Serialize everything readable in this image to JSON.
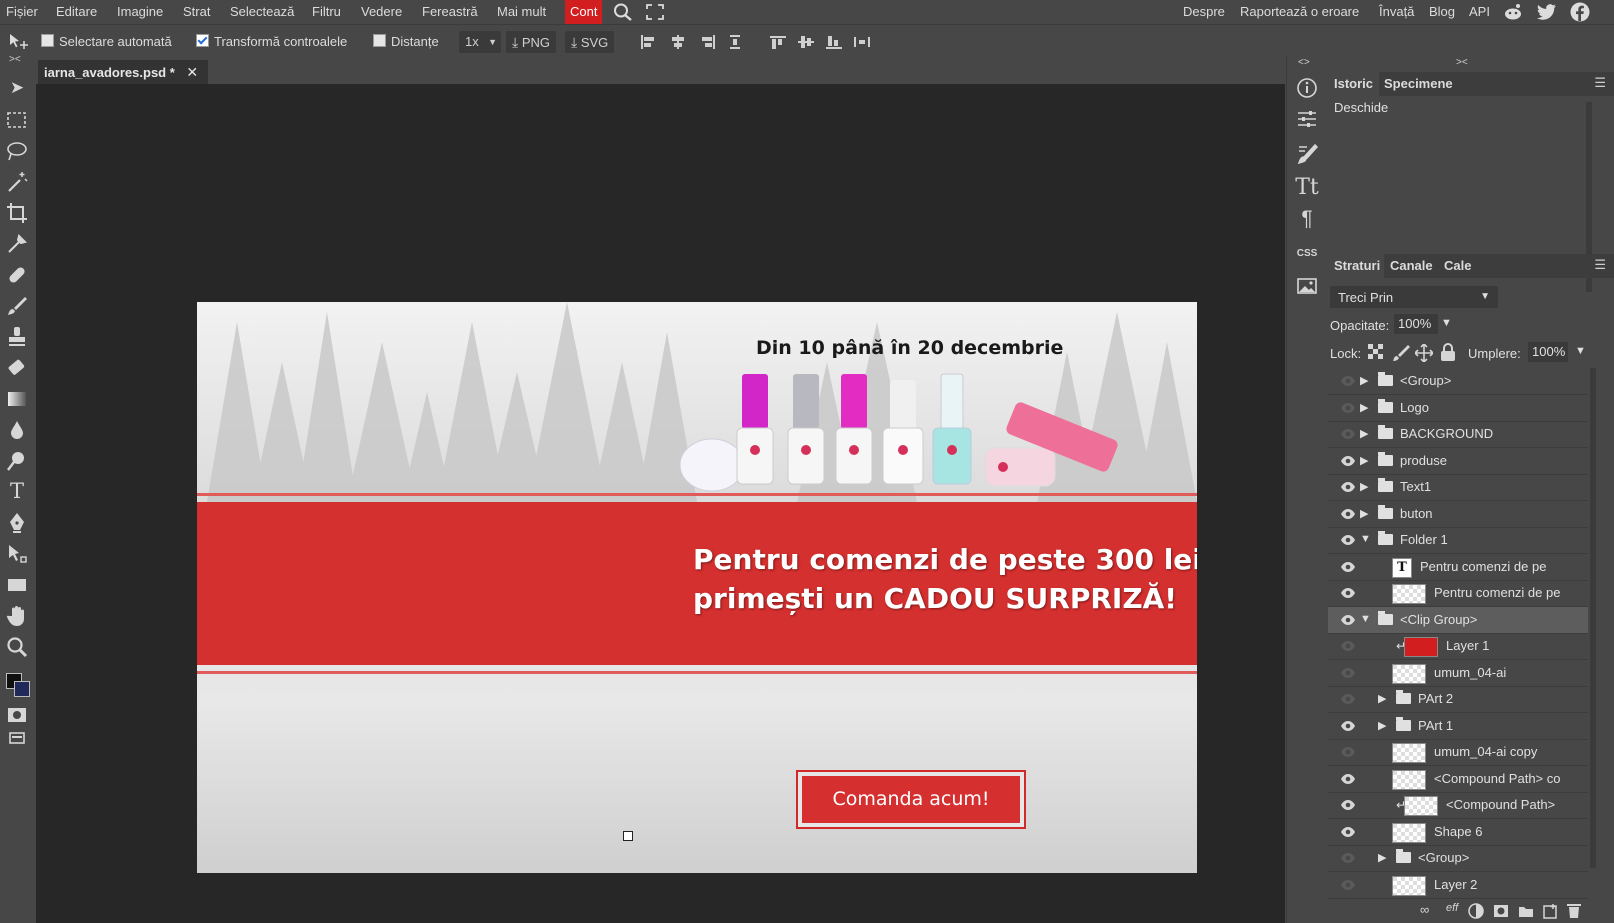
{
  "menu": {
    "items": [
      "Fișier",
      "Editare",
      "Imagine",
      "Strat",
      "Selectează",
      "Filtru",
      "Vedere",
      "Fereastră",
      "Mai mult",
      "Cont"
    ],
    "active": "Cont",
    "right_links": [
      "Despre",
      "Raportează o eroare",
      "Învață",
      "Blog",
      "API"
    ]
  },
  "options": {
    "auto_select": "Selectare automată",
    "auto_select_checked": false,
    "transform_controls": "Transformă controalele",
    "transform_controls_checked": true,
    "distances": "Distanțe",
    "distances_checked": false,
    "zoom": "1x",
    "png": "PNG",
    "svg": "SVG"
  },
  "document": {
    "tab_title": "iarna_avadores.psd *",
    "banner": {
      "date_text": "Din 10 până în 20 decembrie",
      "headline_1": "Pentru comenzi de peste 300 lei",
      "headline_2": "primești un CADOU SURPRIZĂ!",
      "cta": "Comanda acum!"
    }
  },
  "panels": {
    "history_tabs": [
      "Istoric",
      "Specimene"
    ],
    "history_items": [
      "Deschide"
    ],
    "mini_css": "CSS",
    "layer_tabs": [
      "Straturi",
      "Canale",
      "Cale"
    ],
    "blend_mode": "Treci Prin",
    "opacity_label": "Opacitate:",
    "opacity_value": "100%",
    "lock_label": "Lock:",
    "fill_label": "Umplere:",
    "fill_value": "100%",
    "layers": [
      {
        "name": "<Group>",
        "type": "folder",
        "indent": 0,
        "visible": false,
        "expanded": false
      },
      {
        "name": "Logo",
        "type": "folder",
        "indent": 0,
        "visible": false,
        "expanded": false
      },
      {
        "name": "BACKGROUND",
        "type": "folder",
        "indent": 0,
        "visible": false,
        "expanded": false
      },
      {
        "name": "produse",
        "type": "folder",
        "indent": 0,
        "visible": true,
        "expanded": false
      },
      {
        "name": "Text1",
        "type": "folder",
        "indent": 0,
        "visible": true,
        "expanded": false
      },
      {
        "name": "buton",
        "type": "folder",
        "indent": 0,
        "visible": true,
        "expanded": false
      },
      {
        "name": "Folder 1",
        "type": "folder",
        "indent": 0,
        "visible": true,
        "expanded": true
      },
      {
        "name": "Pentru comenzi de pe",
        "type": "text",
        "indent": 1,
        "visible": true
      },
      {
        "name": "Pentru comenzi de pe",
        "type": "raster",
        "indent": 1,
        "visible": true
      },
      {
        "name": "<Clip Group>",
        "type": "folder",
        "indent": 0,
        "visible": true,
        "expanded": true,
        "selected": true
      },
      {
        "name": "Layer 1",
        "type": "red",
        "indent": 2,
        "visible": false,
        "clipped": true
      },
      {
        "name": "umum_04-ai",
        "type": "raster",
        "indent": 1,
        "visible": false
      },
      {
        "name": "PArt 2",
        "type": "folder",
        "indent": 1,
        "visible": false,
        "expanded": false
      },
      {
        "name": "PArt 1",
        "type": "folder",
        "indent": 1,
        "visible": true,
        "expanded": false
      },
      {
        "name": "umum_04-ai copy",
        "type": "raster",
        "indent": 1,
        "visible": false
      },
      {
        "name": "<Compound Path> co",
        "type": "raster",
        "indent": 1,
        "visible": true
      },
      {
        "name": "<Compound Path>",
        "type": "raster",
        "indent": 2,
        "visible": true,
        "clipped": true
      },
      {
        "name": "Shape 6",
        "type": "raster",
        "indent": 1,
        "visible": true
      },
      {
        "name": "<Group>",
        "type": "folder",
        "indent": 1,
        "visible": false,
        "expanded": false
      },
      {
        "name": "Layer 2",
        "type": "raster",
        "indent": 1,
        "visible": false
      }
    ]
  },
  "colors": {
    "accent_red": "#d21e1e",
    "banner_red": "#d4302f",
    "workspace": "#272727",
    "chrome": "#474747"
  }
}
